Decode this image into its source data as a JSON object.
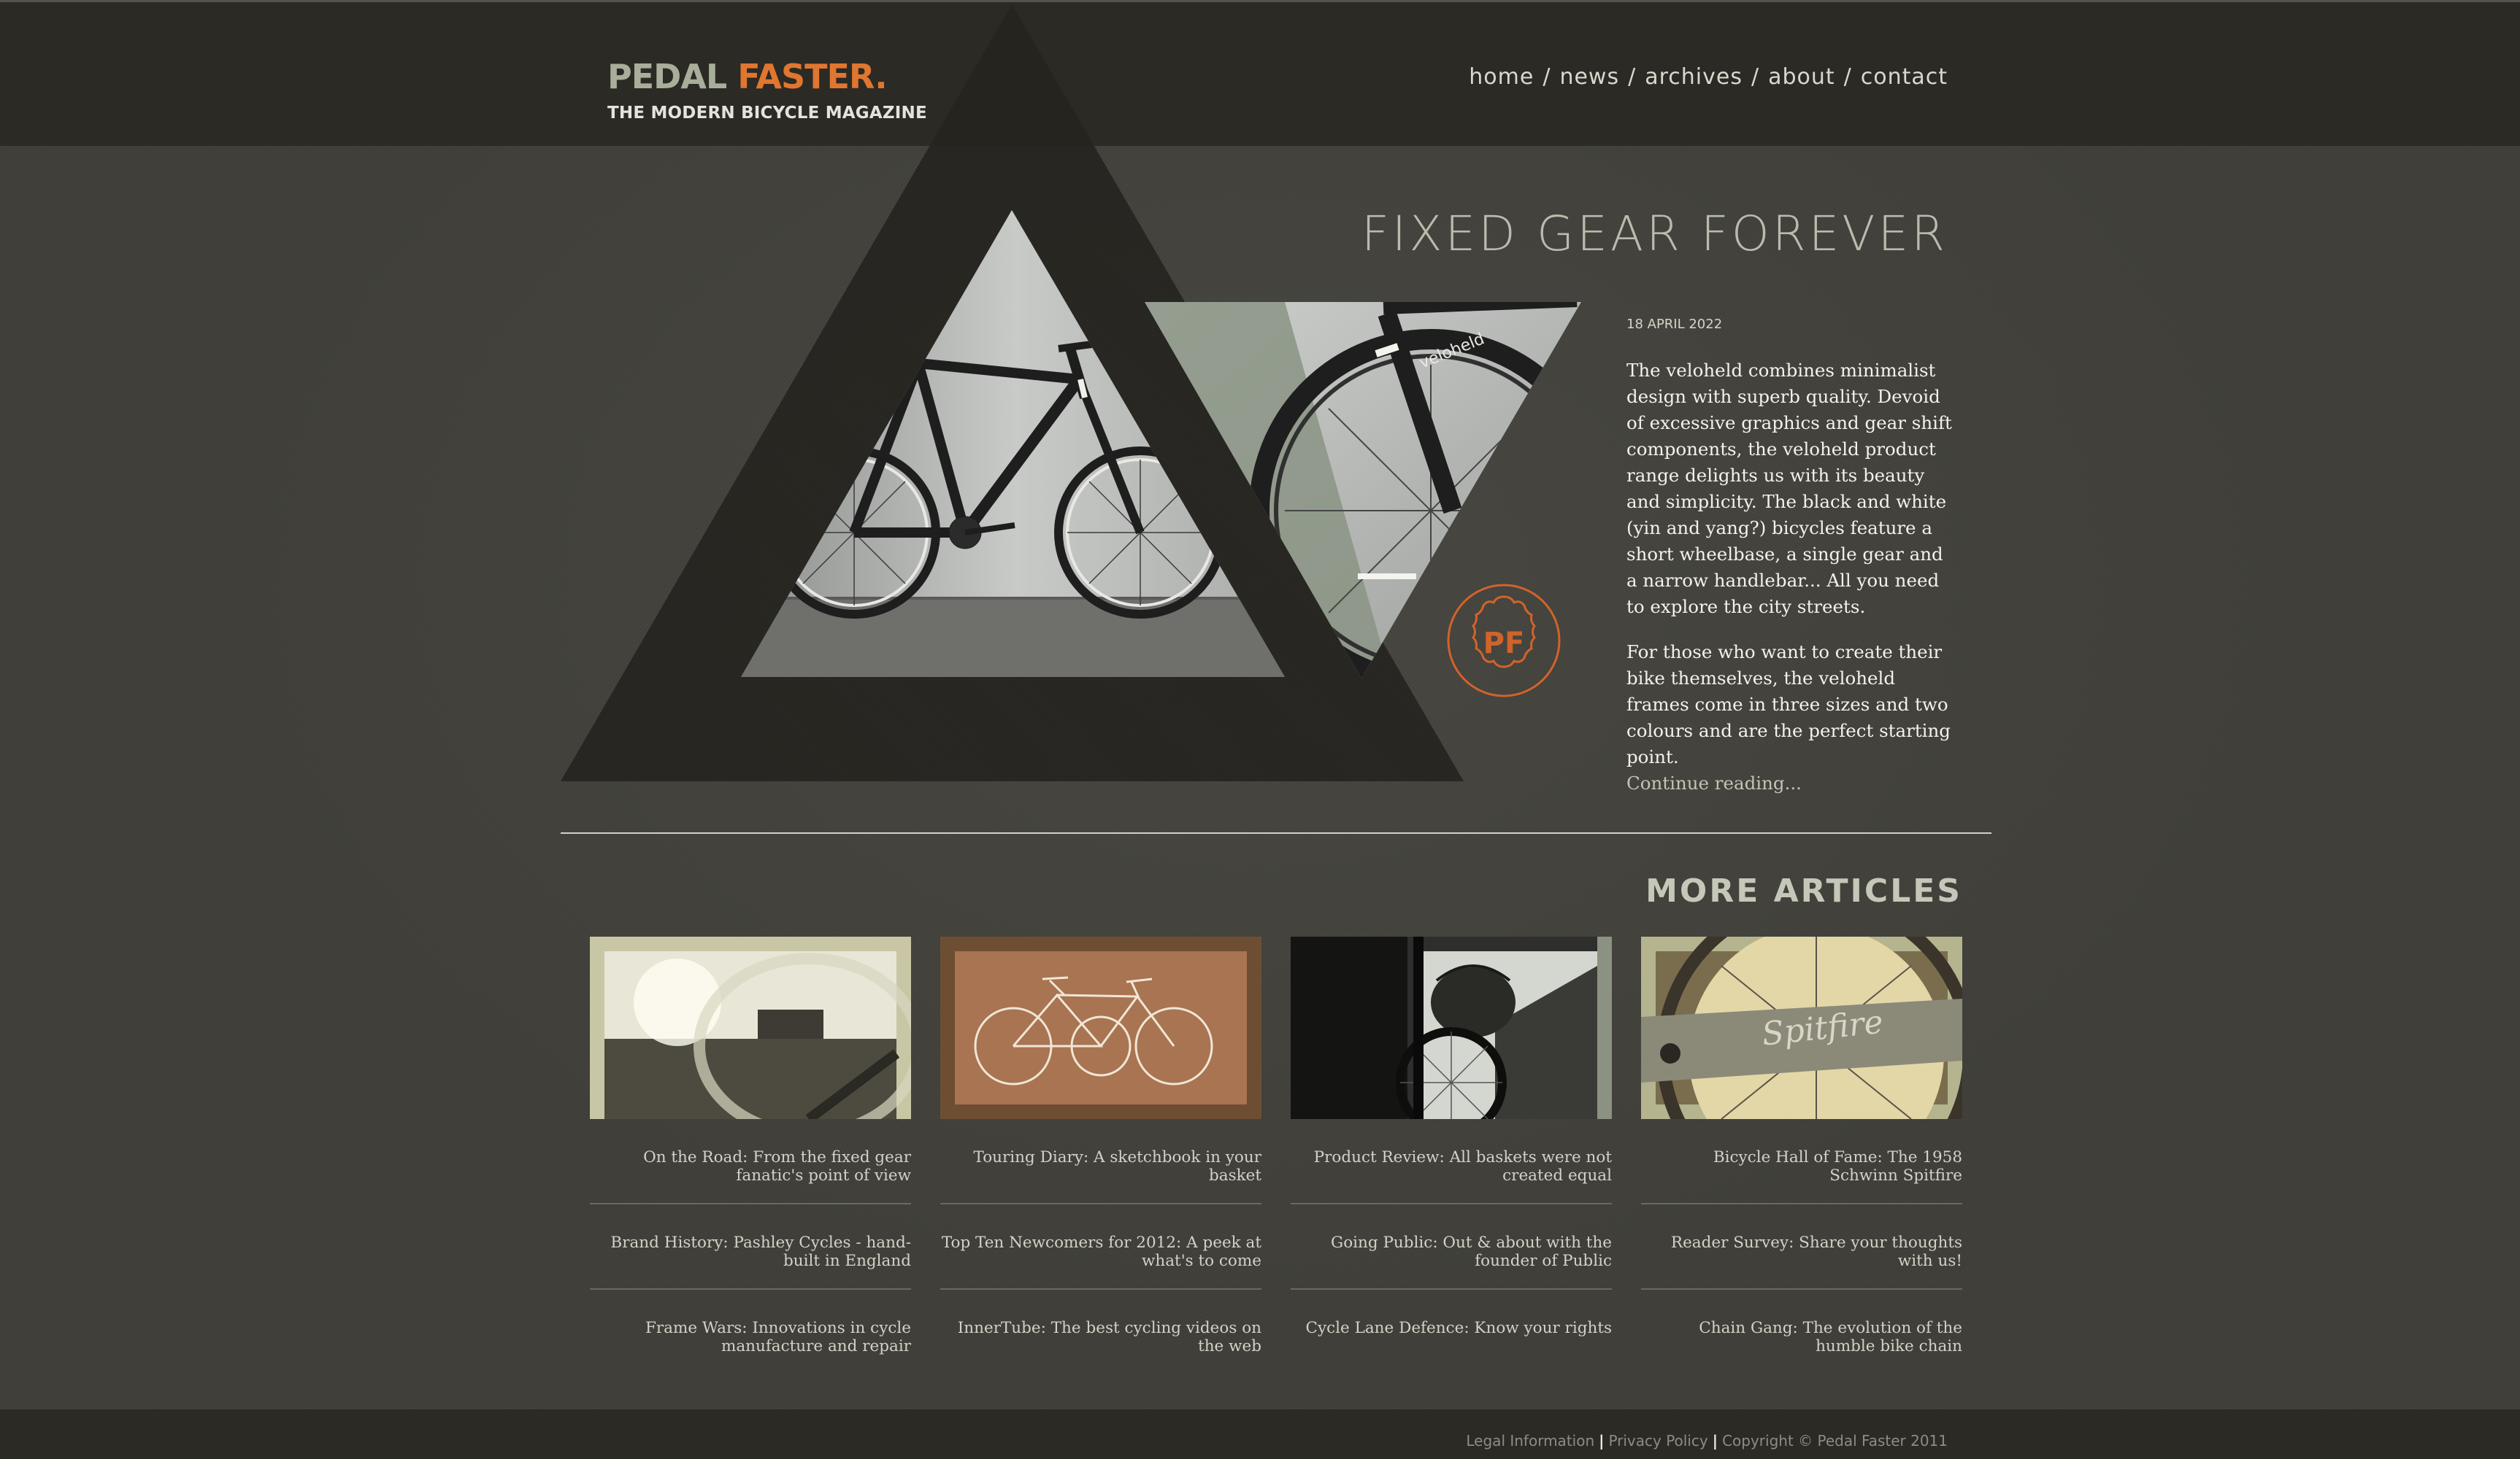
{
  "site": {
    "logo_word1": "PEDAL",
    "logo_word2": "FASTER.",
    "tagline": "THE MODERN BICYCLE MAGAZINE"
  },
  "nav": {
    "items": [
      {
        "label": "home"
      },
      {
        "label": "news"
      },
      {
        "label": "archives"
      },
      {
        "label": "about"
      },
      {
        "label": "contact"
      }
    ],
    "separator": "/"
  },
  "feature": {
    "title": "FIXED GEAR FOREVER",
    "date": "18 APRIL 2022",
    "paragraph1": "The veloheld combines minimalist design with superb quality. Devoid of excessive graphics and gear shift components, the veloheld product range delights us with its beauty and simplicity. The black and white (yin and yang?) bicycles feature a short wheelbase, a single gear and a narrow handlebar... All you need to explore the city streets.",
    "paragraph2": "For those who want to create their bike themselves, the veloheld frames come in three sizes and two colours and are the perfect starting point.",
    "continue_label": "Continue reading...",
    "badge_text": "PF",
    "frame_decal": "veloheld"
  },
  "more_articles": {
    "title": "MORE ARTICLES",
    "columns": [
      {
        "thumb_icon": "road-mirror-photo",
        "articles": [
          "On the Road: From the fixed gear fanatic's point of view",
          "Brand History: Pashley Cycles - hand-built in England",
          "Frame Wars: Innovations in cycle manufacture and repair"
        ]
      },
      {
        "thumb_icon": "bicycle-sketch-image",
        "articles": [
          "Touring Diary: A sketchbook in your basket",
          "Top Ten Newcomers for 2012: A peek at what's to come",
          "InnerTube: The best cycling videos on the web"
        ]
      },
      {
        "thumb_icon": "bicycle-basket-photo",
        "articles": [
          "Product Review: All baskets were not created equal",
          "Going Public: Out & about with the founder of Public",
          "Cycle Lane Defence: Know your rights"
        ]
      },
      {
        "thumb_icon": "schwinn-spitfire-photo",
        "thumb_text": "Spitfire",
        "articles": [
          "Bicycle Hall of Fame: The 1958 Schwinn Spitfire",
          "Reader Survey: Share your thoughts with us!",
          "Chain Gang: The evolution of the humble bike chain"
        ]
      }
    ]
  },
  "footer": {
    "legal": "Legal Information",
    "privacy": "Privacy Policy",
    "copyright": "Copyright © Pedal Faster 2011",
    "separator": "|"
  },
  "colors": {
    "background": "#3f3e38",
    "header_bar": "#2b2a25",
    "accent_orange": "#e0762f",
    "logo_grey": "#a9ae9b",
    "sage": "#b9bbac"
  }
}
